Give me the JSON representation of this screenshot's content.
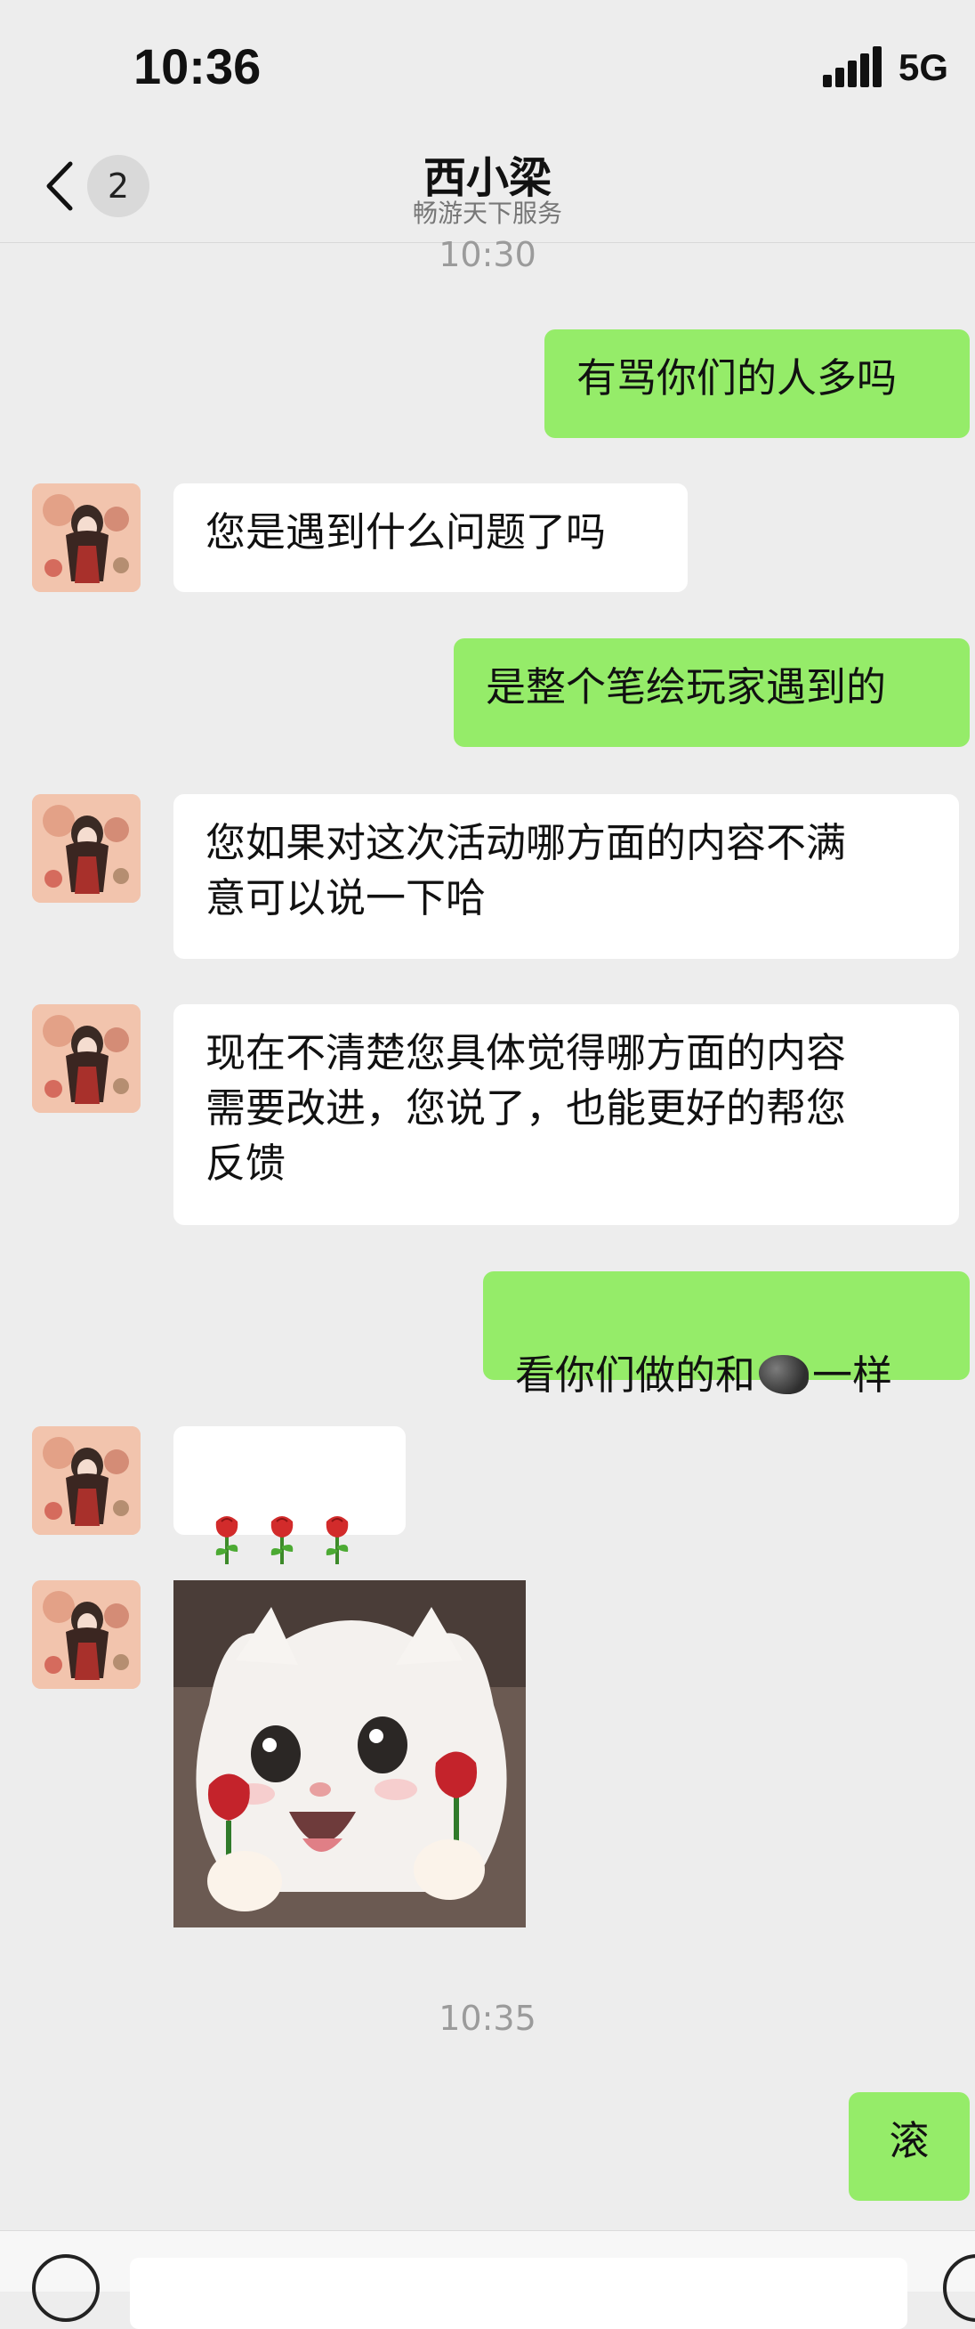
{
  "status": {
    "time": "10:36",
    "network": "5G"
  },
  "header": {
    "back_badge": "2",
    "title": "西小梁",
    "subtitle": "畅游天下服务"
  },
  "timestamps": [
    "10:30",
    "10:35"
  ],
  "messages": [
    {
      "from": "me",
      "text": "有骂你们的人多吗"
    },
    {
      "from": "other",
      "text": "您是遇到什么问题了吗"
    },
    {
      "from": "me",
      "text": "是整个笔绘玩家遇到的"
    },
    {
      "from": "other",
      "text": "您如果对这次活动哪方面的内容不满\n意可以说一下哈"
    },
    {
      "from": "other",
      "text": "现在不清楚您具体觉得哪方面的内容\n需要改进，您说了，也能更好的帮您\n反馈"
    },
    {
      "from": "me",
      "text_before": "看你们做的和",
      "emoji": "rock",
      "text_after": "一样"
    },
    {
      "from": "other",
      "emoji": "rose",
      "count": 3
    },
    {
      "from": "other",
      "sticker": "white-kitten-holding-roses"
    },
    {
      "from": "me",
      "text": "滚"
    }
  ],
  "colors": {
    "background": "#ededed",
    "me_bubble": "#95ec69",
    "other_bubble": "#ffffff"
  }
}
